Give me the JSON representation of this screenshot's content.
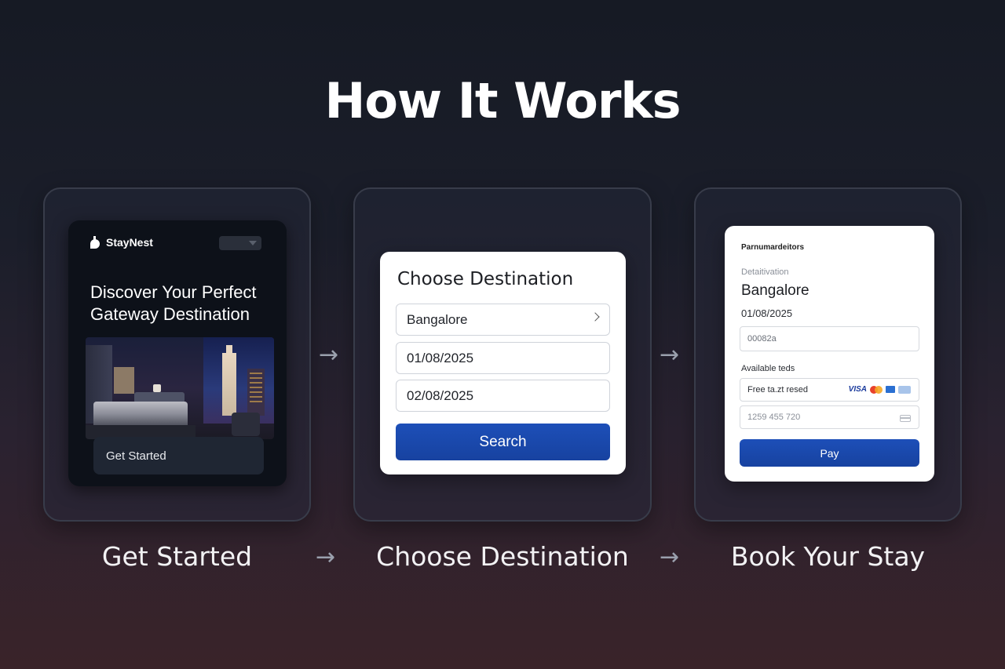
{
  "page": {
    "title": "How It Works"
  },
  "steps": [
    {
      "label": "Get Started"
    },
    {
      "label": "Choose Destination"
    },
    {
      "label": "Book Your Stay"
    }
  ],
  "step1": {
    "brand": "StayNest",
    "hero_title": "Discover Your Perfect Gateway Destination",
    "cta": "Get Started"
  },
  "step2": {
    "title": "Choose Destination",
    "destination": "Bangalore",
    "checkin": "01/08/2025",
    "checkout": "02/08/2025",
    "search_label": "Search"
  },
  "step3": {
    "heading": "Parnumardeitors",
    "sub_label": "Detaitivation",
    "city": "Bangalore",
    "date": "01/08/2025",
    "code_field": "00082a",
    "available_label": "Available teds",
    "payment_option": "Free ta.zt resed",
    "card_brand": "VISA",
    "card_number": "1259 455 720",
    "pay_label": "Pay"
  },
  "colors": {
    "accent": "#1d4fb8",
    "background_top": "#161a24",
    "background_bottom": "#3a2329"
  },
  "icons": [
    "staynest-logo-icon",
    "chevron-right-icon",
    "arrow-right-icon",
    "credit-card-icon",
    "mastercard-icon"
  ]
}
